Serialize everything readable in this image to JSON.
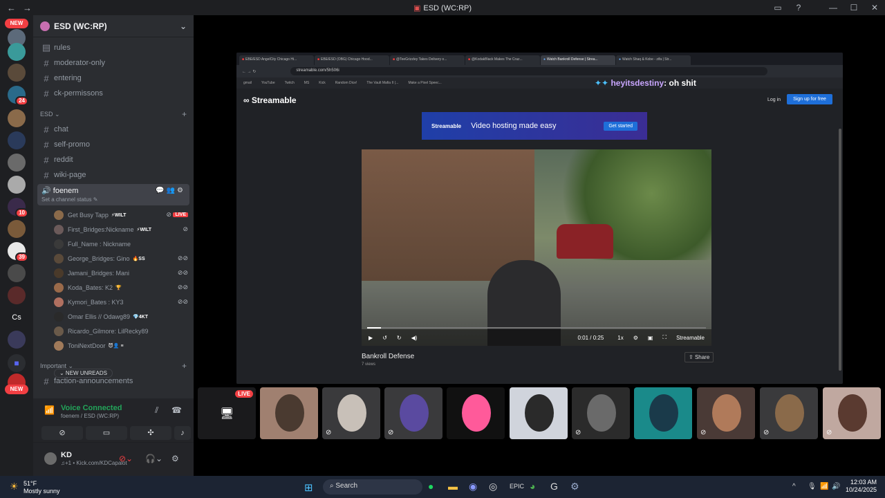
{
  "window": {
    "title": "ESD (WC:RP)",
    "back": "←",
    "forward": "→"
  },
  "server": {
    "name": "ESD (WC:RP)",
    "top_channels": [
      {
        "icon": "▤",
        "label": "rules"
      },
      {
        "icon": "#",
        "label": "moderator-only"
      },
      {
        "icon": "#",
        "label": "entering"
      },
      {
        "icon": "#",
        "label": "ck-permissons"
      }
    ],
    "category_esd": "ESD ⌄",
    "esd_channels": [
      {
        "label": "chat"
      },
      {
        "label": "self-promo"
      },
      {
        "label": "reddit"
      },
      {
        "label": "wiki-page"
      }
    ],
    "voice_channel": {
      "name": "foenem",
      "status": "Set a channel status ✎"
    },
    "members": [
      {
        "name": "Get Busy Tapp",
        "tag": "⚡WILT",
        "live": "LIVE",
        "color": "#8a6a4a"
      },
      {
        "name": "First_Bridges:Nickname",
        "tag": "⚡WILT",
        "color": "#6b5a5a"
      },
      {
        "name": "Full_Name : Nickname",
        "tag": "",
        "color": "#3a3a3a"
      },
      {
        "name": "George_Bridges: Gino",
        "tag": "🔥SS",
        "color": "#5a4a3a"
      },
      {
        "name": "Jamani_Bridges: Mani",
        "tag": "",
        "color": "#4a3a2a"
      },
      {
        "name": "Koda_Bates: K2",
        "tag": "🏆",
        "color": "#9a6a4a"
      },
      {
        "name": "Kymori_Bates : KY3",
        "tag": "",
        "color": "#b07060"
      },
      {
        "name": "Omar Ellis // Odawg89",
        "tag": "💎4KT",
        "color": "#2a2a2a"
      },
      {
        "name": "Ricardo_Gilmore: LilRecky89",
        "tag": "",
        "color": "#6a5a4a"
      },
      {
        "name": "ToniNextDoor",
        "tag": "😈👤 ≡",
        "color": "#a07a5a"
      }
    ],
    "category_important": "Important ⌄",
    "important_channels": [
      {
        "label": "faction-announcements"
      }
    ],
    "new_unreads": "⌄ NEW UNREADS",
    "rail_badges": {
      "new_top": "NEW",
      "b24": "24",
      "b10": "10",
      "b39": "39",
      "new_bottom": "NEW"
    }
  },
  "voice_panel": {
    "title": "Voice Connected",
    "subtitle": "foenem / ESD (WC:RP)"
  },
  "user": {
    "name": "KD",
    "status": "♫+1 • Kick.com/KDCapalot"
  },
  "stream": {
    "tabs": [
      "EBE/ESD AngelCity Chicago Hi...",
      "EBE/ESD (OBG) Chicago Hood...",
      "@TeeGrizzley Takes Delivery o...",
      "@KodakBlack Makes The Craz...",
      "Watch Bankroll Defense | Strea...",
      "Watch Shaq & Kobe - zifa | Str..."
    ],
    "url": "streamable.com/5h506i",
    "bookmarks": [
      "gmail",
      "YouTube",
      "Twitch",
      "MS",
      "Kick",
      "Random Dice!",
      "The Vault Mafia II (...",
      "Make a Pixel Speec..."
    ],
    "chat_user": "heyitsdestiny",
    "chat_msg": ": oh shit",
    "site_logo": "Streamable",
    "login": "Log in",
    "signup": "Sign up for free",
    "ad_logo": "Streamable",
    "ad_text": "Video hosting made easy",
    "ad_button": "Get started",
    "video_time": "0:01 / 0:25",
    "video_speed": "1x",
    "video_brand": "Streamable",
    "video_progress": 0.04,
    "video_title": "Bankroll Defense",
    "video_views": "7 views",
    "share": "Share"
  },
  "strip": {
    "live_label": "LIVE"
  },
  "taskbar": {
    "temp": "51°F",
    "weather": "Mostly sunny",
    "search": "Search",
    "time": "12:03 AM",
    "date": "10/24/2025"
  }
}
